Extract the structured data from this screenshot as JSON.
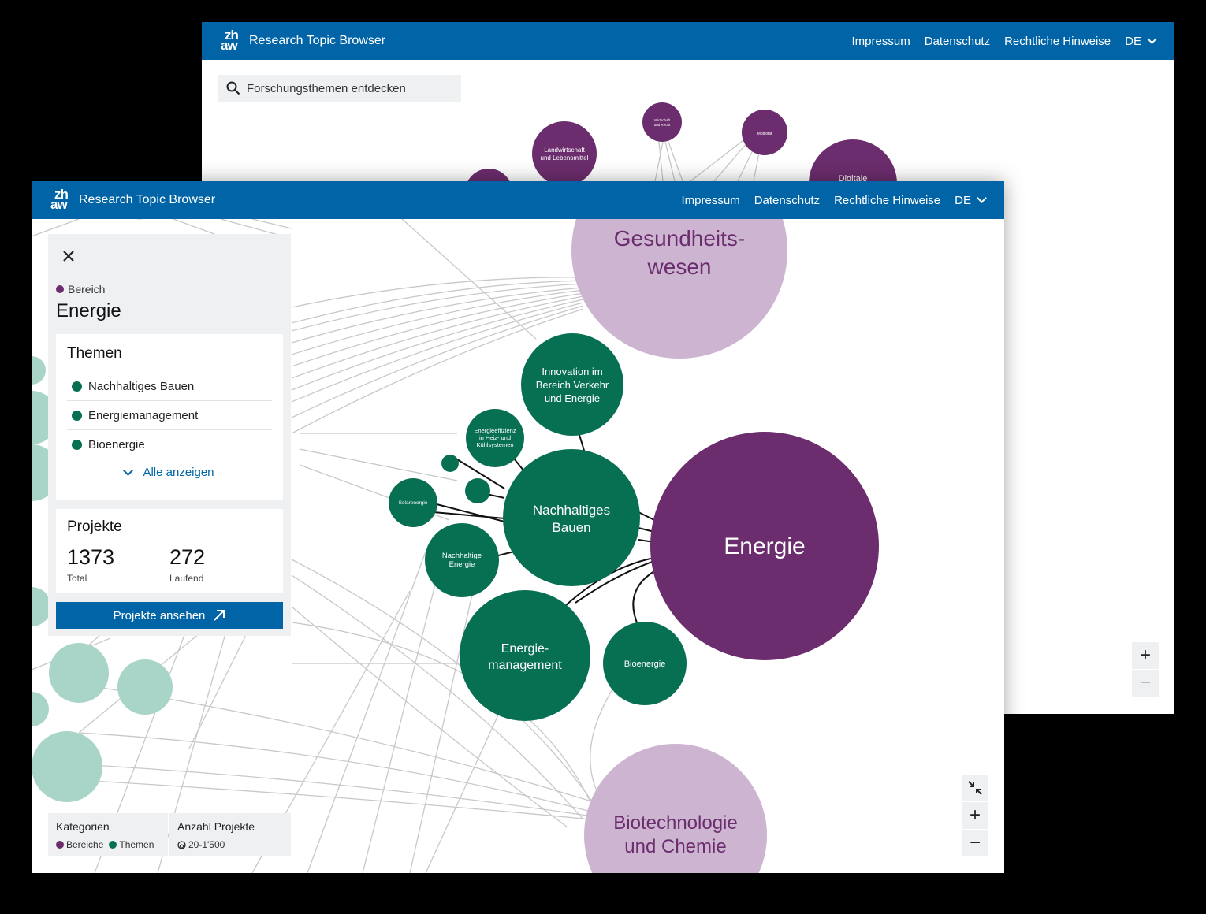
{
  "app": {
    "logo_top": "zh",
    "logo_bottom": "aw",
    "title": "Research Topic Browser"
  },
  "nav": {
    "links": [
      "Impressum",
      "Datenschutz",
      "Rechtliche Hinweise"
    ],
    "language": "DE"
  },
  "search": {
    "placeholder": "Forschungsthemen entdecken"
  },
  "back_graph": {
    "nodes": [
      {
        "label": "Landwirtschaft und Lebensmittel",
        "lines": [
          "Landwirtschaft",
          "und Lebensmittel"
        ]
      },
      {
        "label": "Wirtschaft und Recht",
        "lines": [
          "Wirtschaft",
          "und Recht"
        ]
      },
      {
        "label": "Mobilität",
        "lines": [
          "Mobilität"
        ]
      },
      {
        "label": "Digitale",
        "lines": [
          "Digitale"
        ]
      }
    ]
  },
  "front_graph": {
    "nodes": [
      {
        "label": "Gesundheitswesen",
        "lines": [
          "Gesundheits-",
          "wesen"
        ]
      },
      {
        "label": "Energie",
        "lines": [
          "Energie"
        ]
      },
      {
        "label": "Biotechnologie und Chemie",
        "lines": [
          "Biotechnologie",
          "und Chemie"
        ]
      },
      {
        "label": "Innovation im Bereich Verkehr und Energie",
        "lines": [
          "Innovation im",
          "Bereich Verkehr",
          "und Energie"
        ]
      },
      {
        "label": "Energieeffizienz in Heiz- und Kühlsystemen",
        "lines": [
          "Energieeffizienz",
          "in Heiz- und",
          "Kühlsystemen"
        ]
      },
      {
        "label": "Nachhaltiges Bauen",
        "lines": [
          "Nachhaltiges",
          "Bauen"
        ]
      },
      {
        "label": "Solarenergie",
        "lines": [
          "Solarenergie"
        ]
      },
      {
        "label": "Nachhaltige Energie",
        "lines": [
          "Nachhaltige",
          "Energie"
        ]
      },
      {
        "label": "Energiemanagement",
        "lines": [
          "Energie-",
          "management"
        ]
      },
      {
        "label": "Bioenergie",
        "lines": [
          "Bioenergie"
        ]
      }
    ]
  },
  "panel": {
    "category": "Bereich",
    "title": "Energie",
    "themes_title": "Themen",
    "themes": [
      "Nachhaltiges Bauen",
      "Energiemanagement",
      "Bioenergie"
    ],
    "show_all": "Alle anzeigen",
    "projects_title": "Projekte",
    "projects_total": "1373",
    "projects_total_label": "Total",
    "projects_running": "272",
    "projects_running_label": "Laufend",
    "cta": "Projekte ansehen"
  },
  "legend": {
    "categories_title": "Kategorien",
    "categories": [
      "Bereiche",
      "Themen"
    ],
    "projects_title": "Anzahl Projekte",
    "projects_range": "20-1'500"
  },
  "colors": {
    "nav_blue": "#0064a6",
    "area_purple": "#6b2d6d",
    "area_light_purple": "#cdb5d2",
    "topic_green": "#087052",
    "topic_light_green": "#a8d5c8",
    "panel_grey": "#eef0f2"
  },
  "icons": {
    "search": "search-icon",
    "close": "close-icon",
    "arrow": "arrow-up-right-icon",
    "collapse": "collapse-icon"
  }
}
